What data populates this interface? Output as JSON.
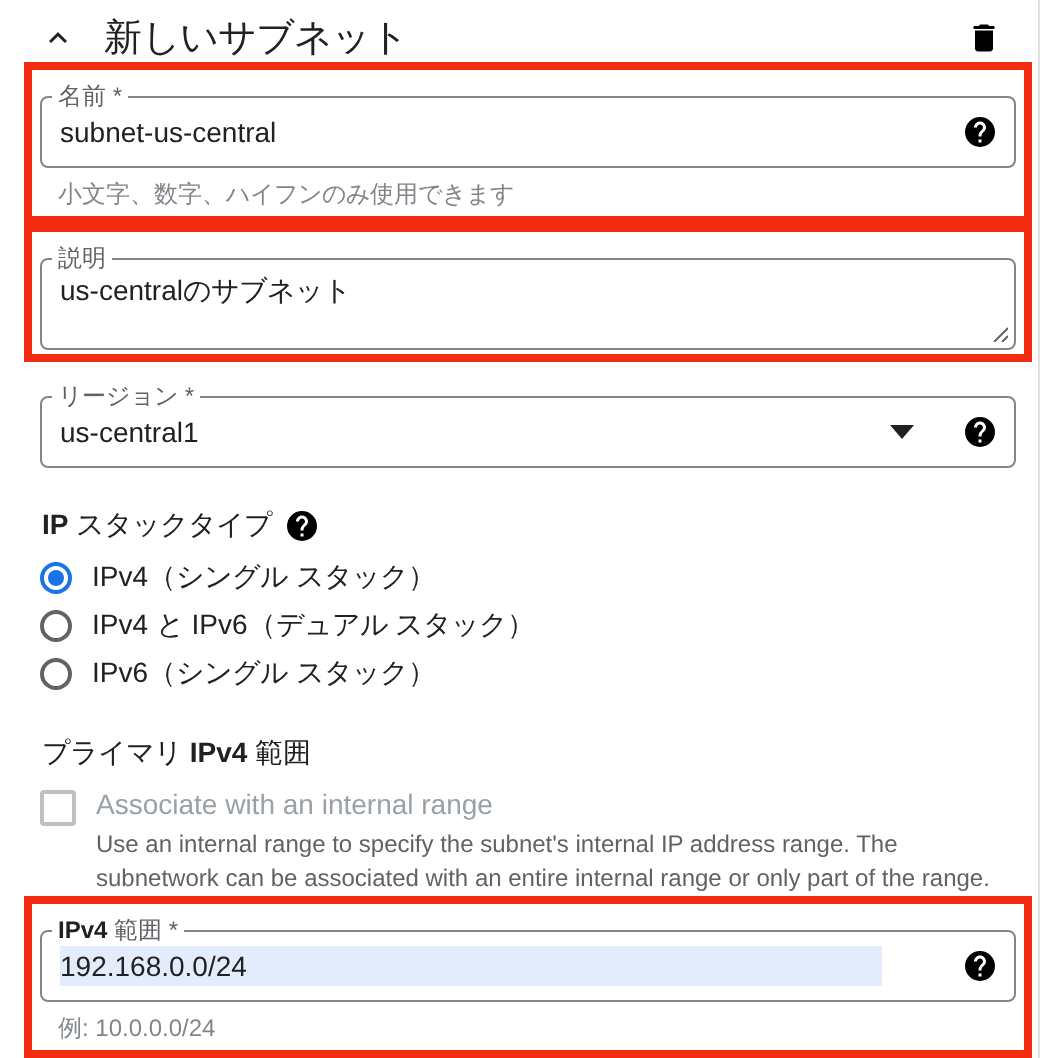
{
  "header": {
    "title": "新しいサブネット",
    "expanded": true
  },
  "fields_top": [
    {
      "kind": "text",
      "label": "名前 *",
      "value": "subnet-us-central",
      "help": true,
      "hint": "小文字、数字、ハイフンのみ使用できます",
      "highlighted": true
    },
    {
      "kind": "textarea",
      "label": "説明",
      "value": "us-centralのサブネット",
      "help": false,
      "highlighted": true
    },
    {
      "kind": "select",
      "label": "リージョン *",
      "value": "us-central1",
      "help": true,
      "highlighted": false
    }
  ],
  "ip_stack": {
    "label": "**IP** スタックタイプ",
    "options": [
      {
        "label": "IPv4（シングル スタック）",
        "selected": true
      },
      {
        "label": "IPv4 と IPv6（デュアル スタック）",
        "selected": false
      },
      {
        "label": "IPv6（シングル スタック）",
        "selected": false
      }
    ]
  },
  "primary_range": {
    "label": "プライマリ **IPv4** 範囲",
    "checkbox": {
      "label": "Associate with an internal range",
      "checked": false,
      "disabled": true,
      "description": "Use an internal range to specify the subnet's internal IP address range. The subnetwork can be associated with an entire internal range or only part of the range."
    }
  },
  "fields_bottom": [
    {
      "kind": "text",
      "label": "**IPv4** 範囲 *",
      "value": "192.168.0.0/24",
      "value_selected": true,
      "help": true,
      "hint": "例: 10.0.0.0/24",
      "highlighted": true
    }
  ]
}
